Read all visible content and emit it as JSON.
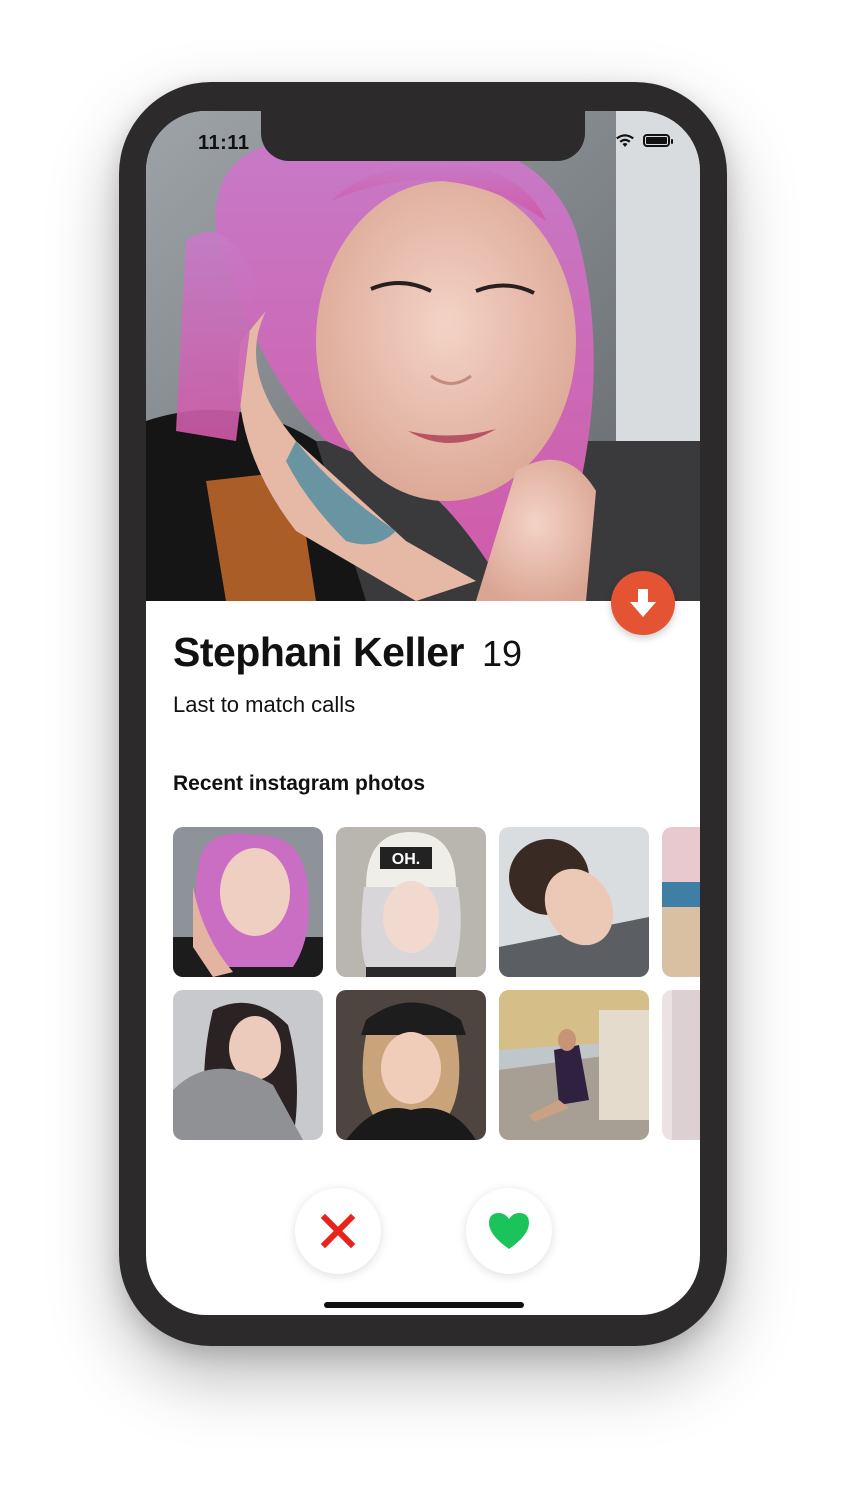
{
  "status_bar": {
    "time": "11:11"
  },
  "profile": {
    "name": "Stephani Keller",
    "age": "19",
    "tagline": "Last to match calls"
  },
  "instagram": {
    "section_title": "Recent instagram photos",
    "photos": [
      {
        "subject": "pink-hair-selfie"
      },
      {
        "subject": "beanie-portrait"
      },
      {
        "subject": "dark-hair-tilted"
      },
      {
        "subject": "beach"
      },
      {
        "subject": "grey-sweater-portrait"
      },
      {
        "subject": "cap-selfie"
      },
      {
        "subject": "street-sitting"
      },
      {
        "subject": "pale-room"
      }
    ]
  },
  "actions": {
    "dislike": "x-icon",
    "like": "heart-icon",
    "expand": "arrow-down-icon"
  },
  "colors": {
    "accent_orange": "#e45432",
    "dislike_red": "#e8231c",
    "like_green": "#1bc45a",
    "phone_frame": "#2c2a2b"
  }
}
